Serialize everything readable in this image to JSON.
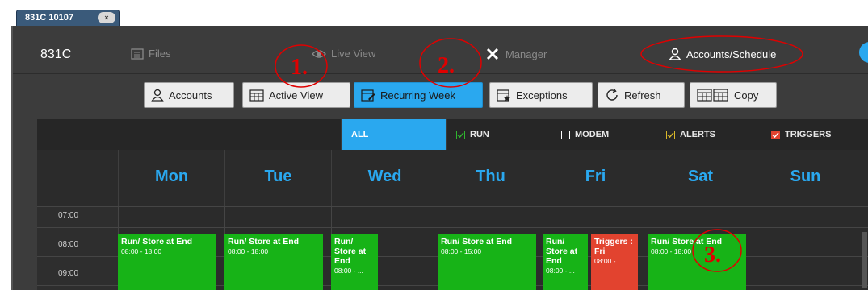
{
  "window_tab": {
    "title": "831C 10107",
    "close": "×"
  },
  "brand": "831C",
  "nav": [
    {
      "label": "Files",
      "icon": "files-icon"
    },
    {
      "label": "Live View",
      "icon": "eye-icon"
    },
    {
      "label": "Manager",
      "icon": "wrench-icon"
    },
    {
      "label": "Accounts/Schedule",
      "icon": "user-icon"
    }
  ],
  "toolbar": [
    {
      "label": "Accounts",
      "icon": "user-icon"
    },
    {
      "label": "Active View",
      "icon": "calendar-icon"
    },
    {
      "label": "Recurring Week",
      "icon": "calendar-edit-icon"
    },
    {
      "label": "Exceptions",
      "icon": "calendar-star-icon"
    },
    {
      "label": "Refresh",
      "icon": "refresh-icon"
    },
    {
      "label": "Copy",
      "icon": "copy-calendar-icon"
    }
  ],
  "filters": [
    {
      "label": "ALL",
      "checkbox": "none"
    },
    {
      "label": "RUN",
      "checkbox": "#2fb52f"
    },
    {
      "label": "MODEM",
      "checkbox": "#ffffff"
    },
    {
      "label": "ALERTS",
      "checkbox": "#d9b82a"
    },
    {
      "label": "TRIGGERS",
      "checkbox": "#e2432f"
    }
  ],
  "days": [
    "Mon",
    "Tue",
    "Wed",
    "Thu",
    "Fri",
    "Sat",
    "Sun"
  ],
  "times": [
    "07:00",
    "08:00",
    "09:00"
  ],
  "events": [
    {
      "title": "Run/ Store at End",
      "time": "08:00 - 18:00"
    },
    {
      "title": "Run/ Store at End",
      "time": "08:00 - 18:00"
    },
    {
      "title": "Run/ Store at End",
      "time": "08:00 - ..."
    },
    {
      "title": "Run/ Store at End",
      "time": "08:00 - 15:00"
    },
    {
      "title": "Run/ Store at End",
      "time": "08:00 - ..."
    },
    {
      "title": "Triggers : Fri",
      "time": "08:00 - ..."
    },
    {
      "title": "Run/ Store at End",
      "time": "08:00 - 18:00"
    }
  ],
  "annotations": {
    "one": "1.",
    "two": "2.",
    "three": "3."
  },
  "colors": {
    "accent": "#2aa8ef",
    "run_green": "#17b317",
    "trigger_red": "#e2432f",
    "annotation_red": "#e00000"
  }
}
